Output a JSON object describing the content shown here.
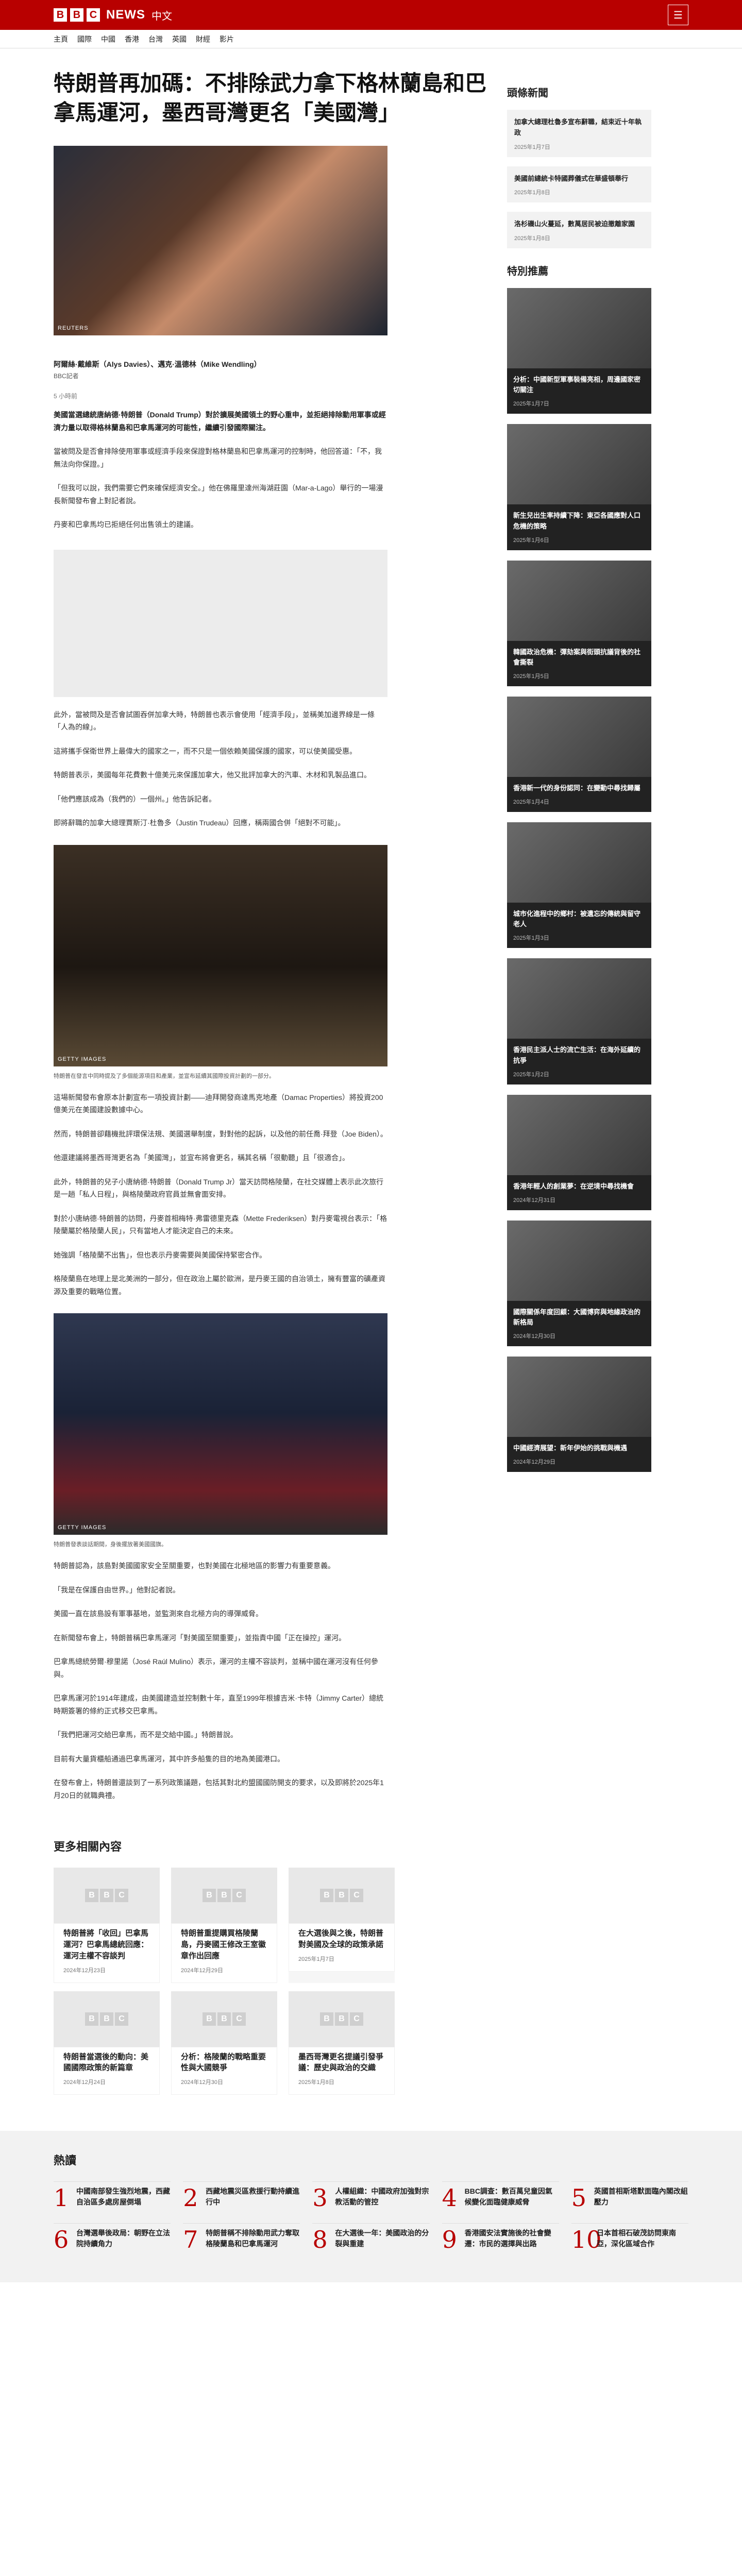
{
  "header": {
    "logo_letters": [
      "B",
      "B",
      "C"
    ],
    "brand_news": "NEWS",
    "brand_zh": "中文",
    "menu_icon": "menu-icon"
  },
  "nav": [
    "主頁",
    "國際",
    "中國",
    "香港",
    "台灣",
    "英國",
    "財經",
    "影片"
  ],
  "article": {
    "title": "特朗普再加碼：不排除武力拿下格林蘭島和巴拿馬運河，墨西哥灣更名「美國灣」",
    "hero_credit": "REUTERS",
    "byline": "阿爾絲·戴維斯（Alys Davies）、邁克·溫德林（Mike Wendling）",
    "byline_org": "BBC記者",
    "date": "5 小時前",
    "lead": "美國當選總統唐納德·特朗普（Donald Trump）對於擴展美國領土的野心重申，並拒絕排除動用軍事或經濟力量以取得格林蘭島和巴拿馬運河的可能性，繼續引發國際關注。",
    "paras_1": [
      "當被問及是否會排除使用軍事或經濟手段來保證對格林蘭島和巴拿馬運河的控制時，他回答道：「不，我無法向你保證。」",
      "「但我可以說，我們需要它們來確保經濟安全。」他在佛羅里達州海湖莊園（Mar-a-Lago）舉行的一場漫長新聞發布會上對記者說。",
      "丹麥和巴拿馬均已拒絕任何出售領土的建議。"
    ],
    "paras_2": [
      "此外，當被問及是否會試圖吞併加拿大時，特朗普也表示會使用「經濟手段」，並稱美加邊界線是一條「人為的線」。",
      "這將攜手保衛世界上最偉大的國家之一，而不只是一個依賴美國保護的國家，可以使美國受惠。",
      "特朗普表示，美國每年花費數十億美元來保護加拿大，他又批評加拿大的汽車、木材和乳製品進口。",
      "「他們應該成為（我們的）一個州。」他告訴記者。",
      "即將辭職的加拿大總理賈斯汀·杜魯多（Justin Trudeau）回應，稱兩國合併「絕對不可能」。"
    ],
    "fig1_credit": "GETTY IMAGES",
    "fig1_caption": "特朗普在發言中同時提及了多個能源項目和產業，並宣布延續其國際投資計劃的一部分。",
    "paras_3": [
      "這場新聞發布會原本計劃宣布一項投資計劃——迪拜開發商達馬克地產（Damac Properties）將投資200億美元在美國建設數據中心。",
      "然而，特朗普卻藉機批評環保法規、美國選舉制度，對對他的起訴，以及他的前任喬·拜登（Joe Biden）。",
      "他還建議將墨西哥灣更名為「美國灣」，並宣布將會更名，稱其名稱「很動聽」且「很適合」。",
      "此外，特朗普的兒子小唐納德·特朗普（Donald Trump Jr）當天訪問格陵蘭，在社交媒體上表示此次旅行是一趟「私人日程」，與格陵蘭政府官員並無會面安排。",
      "對於小唐納德·特朗普的訪問，丹麥首相梅特·弗雷德里克森（Mette Frederiksen）對丹麥電視台表示：「格陵蘭屬於格陵蘭人民」，只有當地人才能決定自己的未來。",
      "她強調「格陵蘭不出售」，但也表示丹麥需要與美國保持緊密合作。",
      "格陵蘭島在地理上是北美洲的一部分，但在政治上屬於歐洲，是丹麥王國的自治領土，擁有豐富的礦產資源及重要的戰略位置。"
    ],
    "fig2_credit": "GETTY IMAGES",
    "fig2_caption": "特朗普發表談話期間，身後擺放著美國國旗。",
    "paras_4": [
      "特朗普認為，該島對美國國家安全至關重要，也對美國在北極地區的影響力有重要意義。",
      "「我是在保護自由世界。」他對記者說。",
      "美國一直在該島設有軍事基地，並監測來自北極方向的導彈威脅。",
      "在新聞發布會上，特朗普稱巴拿馬運河「對美國至關重要」，並指責中國「正在操控」運河。",
      "巴拿馬總統勞爾·穆里諾（José Raúl Mulino）表示，運河的主權不容談判，並稱中國在運河沒有任何參與。",
      "巴拿馬運河於1914年建成，由美國建造並控制數十年，直至1999年根據吉米·卡特（Jimmy Carter）總統時期簽署的條約正式移交巴拿馬。",
      "「我們把運河交給巴拿馬，而不是交給中國。」特朗普說。",
      "目前有大量貨櫃船通過巴拿馬運河，其中許多船隻的目的地為美國港口。",
      "在發布會上，特朗普還談到了一系列政策議題，包括其對北約盟國國防開支的要求，以及即將於2025年1月20日的就職典禮。"
    ]
  },
  "related": {
    "heading": "更多相關內容",
    "items": [
      {
        "title": "特朗普將「收回」巴拿馬運河？巴拿馬總統回應：運河主權不容談判",
        "date": "2024年12月23日"
      },
      {
        "title": "特朗普重提購買格陵蘭島，丹麥國王修改王室徽章作出回應",
        "date": "2024年12月29日"
      },
      {
        "title": "在大選後與之後，特朗普對美國及全球的政策承諾",
        "date": "2025年1月7日"
      },
      {
        "title": "特朗普當選後的動向：美國國際政策的新篇章",
        "date": "2024年12月24日"
      },
      {
        "title": "分析：格陵蘭的戰略重要性與大國競爭",
        "date": "2024年12月30日"
      },
      {
        "title": "墨西哥灣更名提議引發爭議：歷史與政治的交織",
        "date": "2025年1月8日"
      }
    ]
  },
  "side": {
    "top_heading": "頭條新聞",
    "top_items": [
      {
        "title": "加拿大總理杜魯多宣布辭職，結束近十年執政",
        "date": "2025年1月7日"
      },
      {
        "title": "美國前總統卡特國葬儀式在華盛頓舉行",
        "date": "2025年1月8日"
      },
      {
        "title": "洛杉磯山火蔓延，數萬居民被迫撤離家園",
        "date": "2025年1月8日"
      }
    ],
    "feature_heading": "特別推薦",
    "features": [
      {
        "title": "分析：中國新型軍事裝備亮相，周邊國家密切關注",
        "date": "2025年1月7日"
      },
      {
        "title": "新生兒出生率持續下降：東亞各國應對人口危機的策略",
        "date": "2025年1月6日"
      },
      {
        "title": "韓國政治危機：彈劾案與街頭抗議背後的社會撕裂",
        "date": "2025年1月5日"
      },
      {
        "title": "香港新一代的身份認同：在變動中尋找歸屬",
        "date": "2025年1月4日"
      },
      {
        "title": "城市化進程中的鄉村：被遺忘的傳統與留守老人",
        "date": "2025年1月3日"
      },
      {
        "title": "香港民主派人士的流亡生活：在海外延續的抗爭",
        "date": "2025年1月2日"
      },
      {
        "title": "香港年輕人的創業夢：在逆境中尋找機會",
        "date": "2024年12月31日"
      },
      {
        "title": "國際關係年度回顧：大國博弈與地緣政治的新格局",
        "date": "2024年12月30日"
      },
      {
        "title": "中國經濟展望：新年伊始的挑戰與機遇",
        "date": "2024年12月29日"
      }
    ]
  },
  "hot": {
    "heading": "熱讀",
    "items": [
      "中國南部發生強烈地震，西藏自治區多處房屋倒塌",
      "西藏地震災區救援行動持續進行中",
      "人權組織：中國政府加強對宗教活動的管控",
      "BBC調查：數百萬兒童因氣候變化面臨健康威脅",
      "英國首相斯塔默面臨內閣改組壓力",
      "台灣選舉後政局：朝野在立法院持續角力",
      "特朗普稱不排除動用武力奪取格陵蘭島和巴拿馬運河",
      "在大選後一年：美國政治的分裂與重建",
      "香港國安法實施後的社會變遷：市民的選擇與出路",
      "日本首相石破茂訪問東南亞，深化區域合作"
    ]
  }
}
